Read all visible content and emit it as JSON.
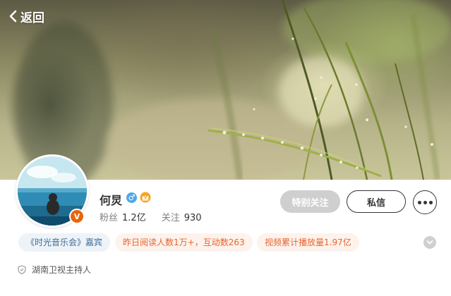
{
  "header": {
    "back_label": "返回"
  },
  "profile": {
    "name": "何炅",
    "gender": "male",
    "gender_glyph": "♂",
    "verified_glyph": "V",
    "crown_icon": "crown-icon",
    "followers_label": "粉丝",
    "followers_value": "1.2亿",
    "following_label": "关注",
    "following_value": "930"
  },
  "actions": {
    "special_follow_label": "特别关注",
    "message_label": "私信",
    "more_icon": "more-dots-icon"
  },
  "tags": [
    {
      "label": "《时光音乐会》嘉宾"
    },
    {
      "label": "昨日阅读人数1万+，互动数263"
    },
    {
      "label": "视频累计播放量1.97亿"
    }
  ],
  "description": "湖南卫视主持人",
  "colors": {
    "accent_orange": "#e8652c",
    "tag_blue_text": "#3d6b96",
    "button_gray": "#cfcfcf",
    "gender_blue": "#4fa8e8",
    "verified_orange": "#e8650a"
  }
}
